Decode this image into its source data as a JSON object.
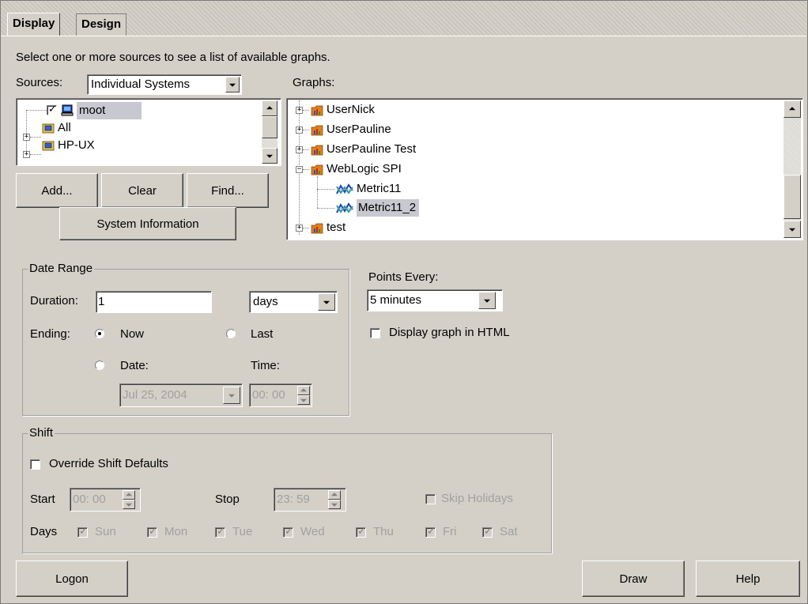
{
  "tabs": [
    {
      "label": "Display",
      "active": true
    },
    {
      "label": "Design",
      "active": false
    }
  ],
  "instruction": "Select one or more sources to see a list of available graphs.",
  "sources": {
    "label": "Sources:",
    "selected": "Individual Systems",
    "tree": [
      {
        "label": "moot",
        "checked": true,
        "selected": true
      },
      {
        "label": "All"
      },
      {
        "label": "HP-UX"
      }
    ]
  },
  "graphs": {
    "label": "Graphs:",
    "tree": [
      {
        "label": "UserNick"
      },
      {
        "label": "UserPauline"
      },
      {
        "label": "UserPauline Test"
      },
      {
        "label": "WebLogic SPI",
        "expanded": true
      },
      {
        "label": "Metric11"
      },
      {
        "label": "Metric11_2",
        "selected": true
      },
      {
        "label": "test"
      }
    ]
  },
  "buttons": {
    "add": "Add...",
    "clear": "Clear",
    "find": "Find...",
    "system_info": "System Information",
    "logon": "Logon",
    "draw": "Draw",
    "help": "Help"
  },
  "date_range": {
    "title": "Date Range",
    "duration_label": "Duration:",
    "duration_value": "1",
    "unit": "days",
    "ending_label": "Ending:",
    "now": "Now",
    "last": "Last",
    "date_label": "Date:",
    "time_label": "Time:",
    "date_value": "Jul 25, 2004",
    "time_value": "00: 00",
    "ending_selected": "Now"
  },
  "points": {
    "label": "Points Every:",
    "value": "5 minutes",
    "html_label": "Display graph in HTML",
    "html_checked": false
  },
  "shift": {
    "title": "Shift",
    "override_label": "Override Shift Defaults",
    "override_checked": false,
    "start_label": "Start",
    "start_value": "00: 00",
    "stop_label": "Stop",
    "stop_value": "23: 59",
    "skip_label": "Skip Holidays",
    "skip_checked": false,
    "days_label": "Days",
    "days": [
      "Sun",
      "Mon",
      "Tue",
      "Wed",
      "Thu",
      "Fri",
      "Sat"
    ],
    "days_checked": true
  }
}
